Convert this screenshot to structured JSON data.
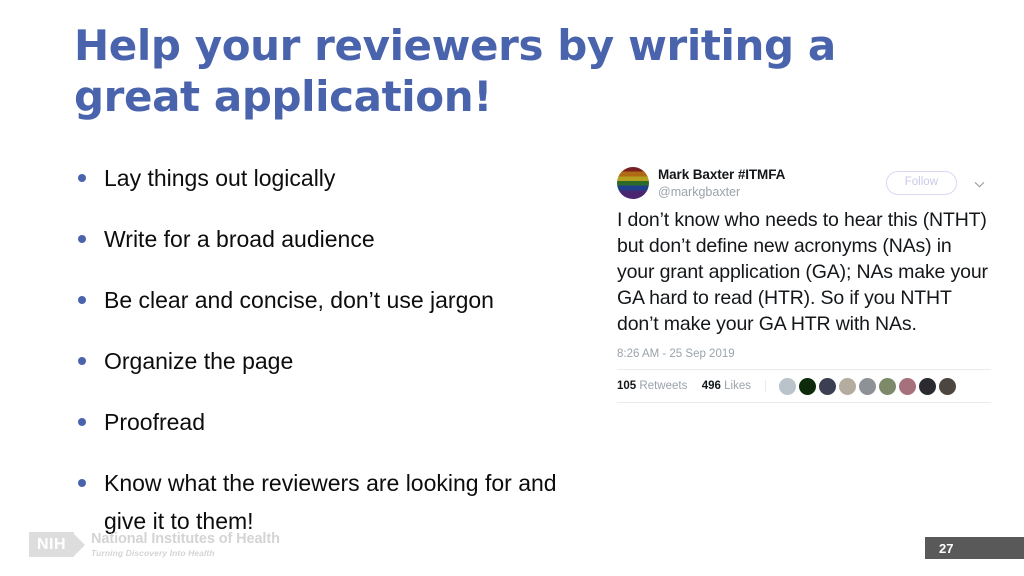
{
  "slide": {
    "title": "Help your reviewers by writing a great application!",
    "page_number": "27",
    "title_color": "#4a63ad",
    "background_color": "#ffffff"
  },
  "bullets": [
    {
      "text": "Lay things out logically"
    },
    {
      "text": "Write for a broad audience"
    },
    {
      "text": "Be clear and concise, don’t use jargon"
    },
    {
      "text": "Organize the page"
    },
    {
      "text": "Proofread"
    },
    {
      "text": "Know what the reviewers are looking for and give it to them!"
    }
  ],
  "tweet": {
    "display_name": "Mark Baxter #ITMFA",
    "handle": "@markgbaxter",
    "follow_label": "Follow",
    "body": "I don’t know who needs to hear this (NTHT) but don’t define new acronyms (NAs) in your grant application (GA); NAs make your GA hard to read (HTR). So if you NTHT don’t make your GA HTR with NAs.",
    "timestamp": "8:26 AM - 25 Sep 2019",
    "retweets_count": "105",
    "retweets_label": "Retweets",
    "likes_count": "496",
    "likes_label": "Likes",
    "avatar_description": "rainbow-pride-flag",
    "liker_avatar_colors": [
      "#b9c3c9",
      "#0d2a0b",
      "#3c3f52",
      "#b5aca0",
      "#8e9296",
      "#7d8a6a",
      "#a6707c",
      "#2a2a30",
      "#4d4540"
    ]
  },
  "footer": {
    "nih_mark": "NIH",
    "nih_title": "National Institutes of Health",
    "nih_tagline": "Turning Discovery Into Health"
  }
}
